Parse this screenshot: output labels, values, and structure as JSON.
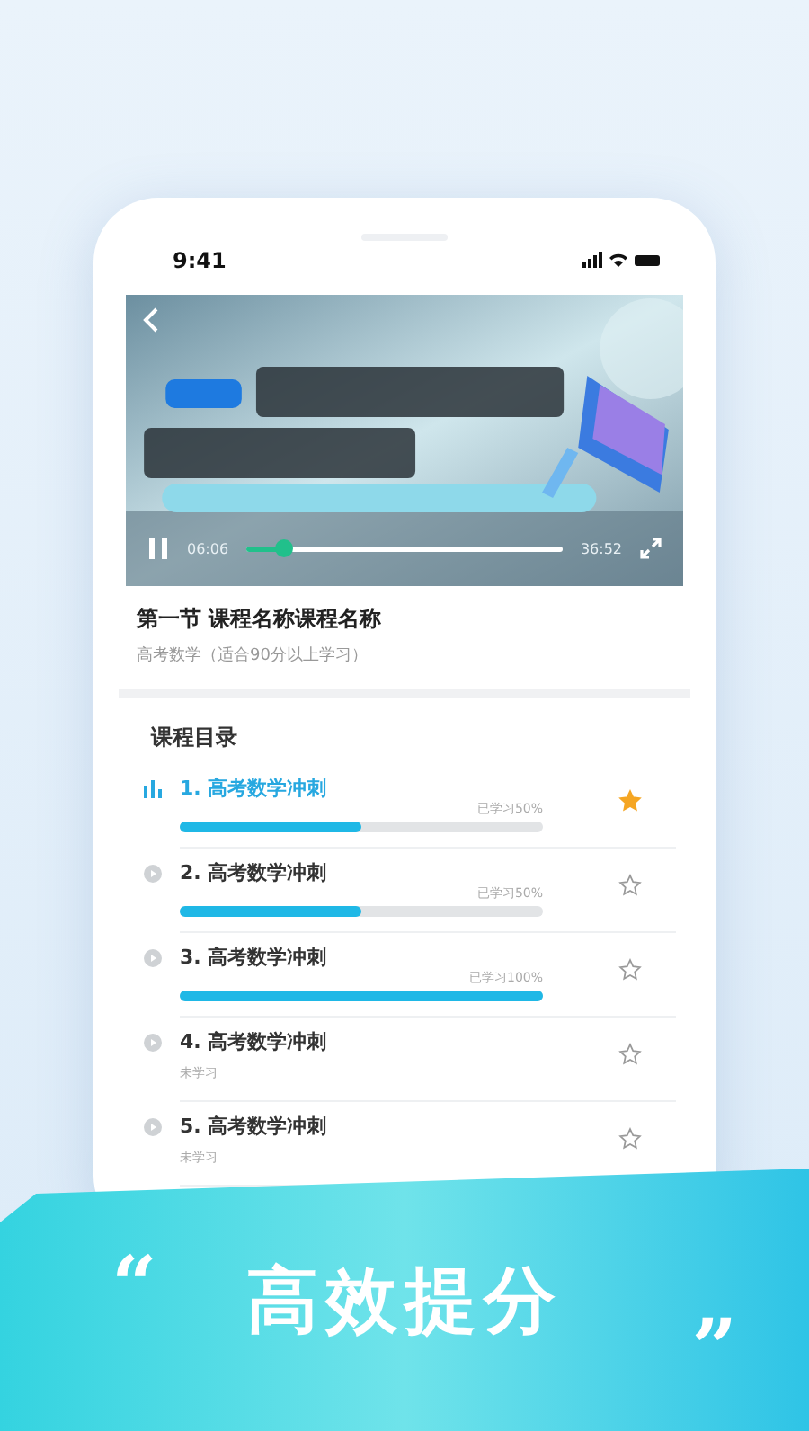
{
  "status_bar": {
    "time": "9:41"
  },
  "player": {
    "current_time": "06:06",
    "duration": "36:52",
    "level": 0.12,
    "playing": true
  },
  "section": {
    "title": "第一节 课程名称课程名称",
    "subtitle": "高考数学（适合90分以上学习）"
  },
  "catalog": {
    "title": "课程目录",
    "lessons": [
      {
        "title": "1. 高考数学冲刺",
        "status": "已学习50%",
        "level": 0.5,
        "selected": true,
        "starred": true
      },
      {
        "title": "2. 高考数学冲刺",
        "status": "已学习50%",
        "level": 0.5,
        "selected": false,
        "starred": false
      },
      {
        "title": "3. 高考数学冲刺",
        "status": "已学习100%",
        "level": 1,
        "selected": false,
        "starred": false
      },
      {
        "title": "4. 高考数学冲刺",
        "status": "未学习",
        "selected": false,
        "starred": false
      },
      {
        "title": "5. 高考数学冲刺",
        "status": "未学习",
        "selected": false,
        "starred": false
      }
    ]
  },
  "banner": {
    "open_quote": "“",
    "headline": "高效提分",
    "close_quote": "”"
  }
}
